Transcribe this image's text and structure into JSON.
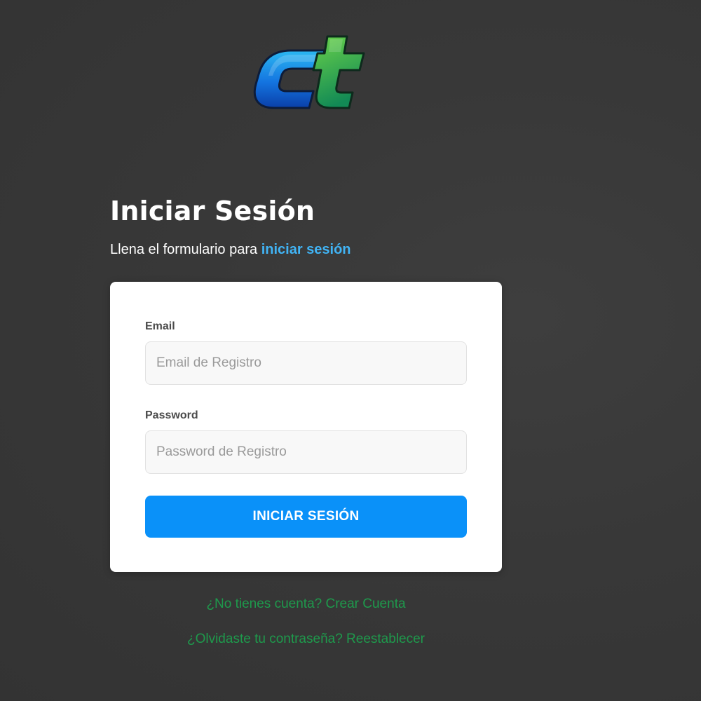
{
  "brand": {
    "logo_text": "ct",
    "colors": {
      "c_light": "#2bb8f2",
      "c_dark": "#0a3fa8",
      "t_light": "#6ad24a",
      "t_dark": "#128a55",
      "outline": "#0d1c3a"
    }
  },
  "header": {
    "title": "Iniciar Sesión",
    "subtitle_prefix": "Llena el formulario para ",
    "subtitle_accent": "iniciar sesión"
  },
  "form": {
    "email": {
      "label": "Email",
      "value": "",
      "placeholder": "Email de Registro"
    },
    "password": {
      "label": "Password",
      "value": "",
      "placeholder": "Password de Registro"
    },
    "submit_label": "INICIAR SESIÓN"
  },
  "links": {
    "create_account": "¿No tienes cuenta? Crear Cuenta",
    "reset_password": "¿Olvidaste tu contraseña? Reestablecer"
  },
  "theme": {
    "background": "#383838",
    "accent_blue": "#41b4f5",
    "button_blue": "#0a91f9",
    "link_green": "#1e9a4c"
  }
}
